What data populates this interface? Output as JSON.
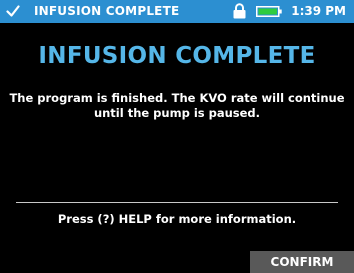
{
  "status_bar": {
    "title": "INFUSION COMPLETE",
    "time": "1:39 PM",
    "background_color": "#2c8fd1",
    "icons": [
      "check-icon",
      "lock-icon",
      "battery-icon"
    ]
  },
  "main": {
    "title": "INFUSION COMPLETE",
    "title_color": "#55b6e8",
    "message": "The program is finished. The KVO rate will continue until the pump is paused.",
    "help_text": "Press (?) HELP for more information."
  },
  "footer": {
    "confirm_label": "CONFIRM",
    "button_color": "#595959"
  }
}
